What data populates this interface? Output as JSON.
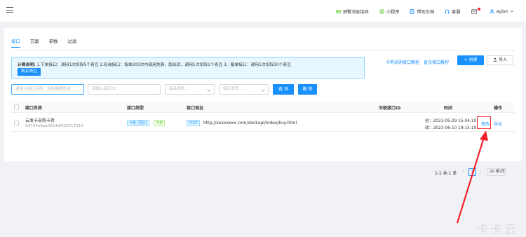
{
  "header": {
    "links": [
      {
        "label": "预警消息接收",
        "icon": "alert-icon"
      },
      {
        "label": "小程序",
        "icon": "mini-program-icon"
      },
      {
        "label": "帮助文档",
        "icon": "book-icon"
      },
      {
        "label": "客服",
        "icon": "headset-icon"
      }
    ],
    "user": "agiso",
    "notification_icon": "mail-icon",
    "user_icon": "user-icon",
    "dropdown_icon": "chevron-down-icon"
  },
  "tabs": [
    "接口",
    "方案",
    "参数",
    "过滤"
  ],
  "notice": {
    "title": "计费说明:",
    "text": " 1.下单接口：调用1次扣除5个奇豆  2.轮询接口：每单200次内调用免费，超出后，调用1次扣除1个奇豆  3、撤单接口：调用1次扣除10个奇豆",
    "buy_label": "购买奇豆"
  },
  "toolbar": {
    "tutorial_links": [
      "卡券采购接口教程",
      "直充接口教程"
    ],
    "create_label": "+ 创建",
    "import_label": "导入",
    "import_icon": "upload-icon"
  },
  "filters": {
    "name_placeholder": "请输入接口名称、支持模糊查询",
    "id_placeholder": "请输入接口ID",
    "product_type_placeholder": "商品类型...",
    "interface_type_placeholder": "接口类型...",
    "query_label": "查 询",
    "delete_label": "删 除"
  },
  "table": {
    "columns": [
      "接口名称",
      "接口类型",
      "接口地址",
      "关联接口ID",
      "时间",
      "操作"
    ],
    "rows": [
      {
        "name": "云发卡采购卡券",
        "id": "64744e6aa0624df5207c7110",
        "type_tags": [
          "卡券 [同步]",
          "下单"
        ],
        "method": "POST",
        "url": "http://xxxxxxxx.com/dockapi/index/buy.html",
        "created": "创：2023-05-29 15:04:10",
        "modified": "改：2023-06-10 19:15:19",
        "actions": [
          "修改",
          "导出"
        ]
      }
    ]
  },
  "pagination": {
    "summary": "1-1 共 1 条",
    "prev": "‹",
    "current": "1",
    "next": "›",
    "page_size": "20 条/页"
  },
  "watermark": "卡卡云",
  "colors": {
    "primary": "#1890ff",
    "annotation": "#f5222d",
    "success": "#52c41a"
  }
}
